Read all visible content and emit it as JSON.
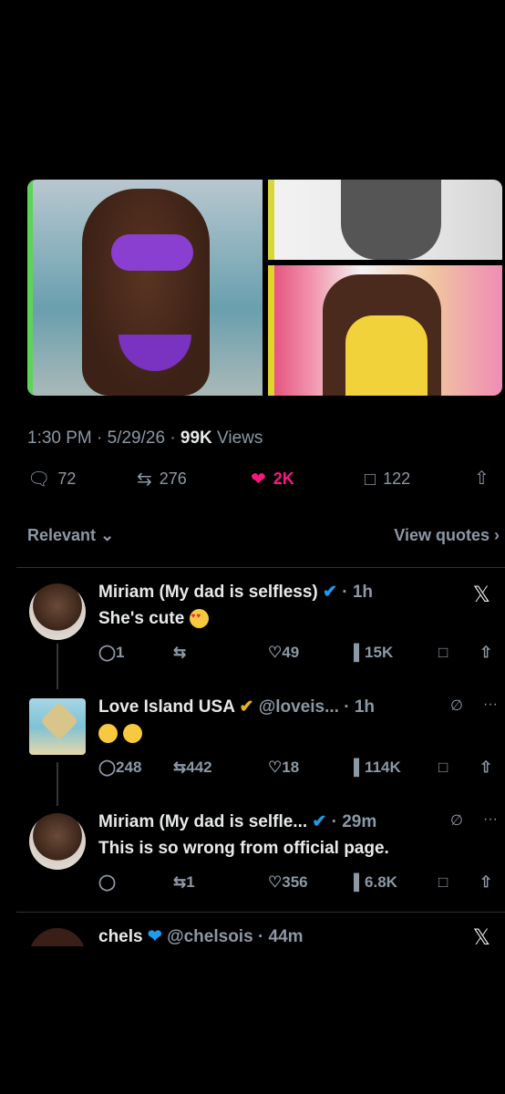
{
  "post": {
    "timestamp": "1:30 PM · 5/29/26 · ",
    "views_count": "99K",
    "views_label": " Views",
    "replies": "72",
    "reposts": "276",
    "likes": "2K",
    "bookmarks": "122"
  },
  "sort": {
    "label": "Relevant",
    "view_quotes": "View quotes"
  },
  "icons": {
    "reply": "reply-icon",
    "repost": "repost-icon",
    "like": "heart-icon",
    "bookmark": "bookmark-icon",
    "share": "share-icon",
    "views": "views-icon",
    "verified": "verified-icon",
    "grok": "grok-icon",
    "more": "more-icon"
  },
  "colors": {
    "like_active": "#f91880",
    "verified_blue": "#1d9bf0",
    "verified_gold": "#e8b31e"
  },
  "replies": [
    {
      "name": "Miriam (My dad is selfless)",
      "time": "· 1h",
      "text": "She's cute",
      "reply_count": "1",
      "repost_count": "",
      "like_count": "49",
      "view_count": "15K"
    },
    {
      "name": "Love Island USA",
      "handle": "@loveis...",
      "time": "· 1h",
      "reply_count": "248",
      "repost_count": "442",
      "like_count": "18",
      "view_count": "114K"
    },
    {
      "name": "Miriam (My dad is selfle...",
      "time": "· 29m",
      "text": "This is so wrong from official page.",
      "reply_count": "",
      "repost_count": "1",
      "like_count": "356",
      "view_count": "6.8K"
    },
    {
      "name": "chels",
      "handle": "@chelsois",
      "time": "· 44m"
    }
  ]
}
